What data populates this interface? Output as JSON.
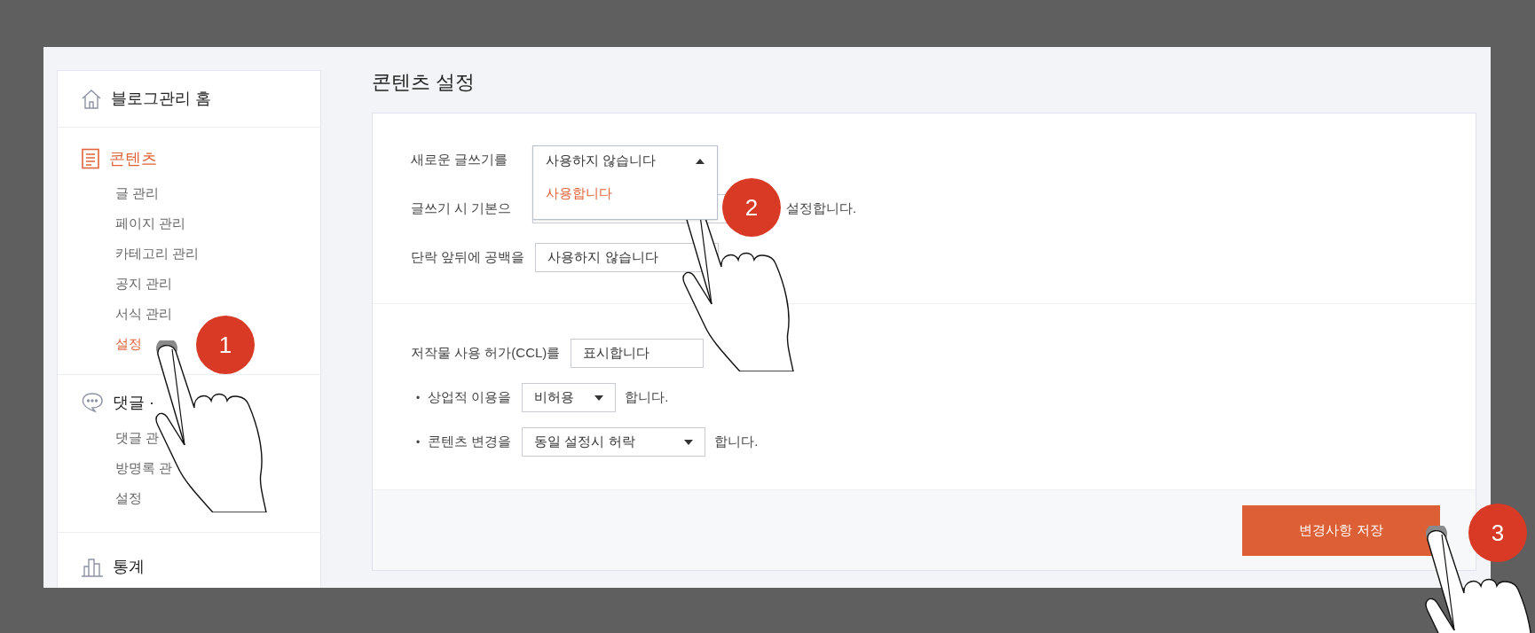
{
  "sidebar": {
    "sections": [
      {
        "title": "블로그관리 홈",
        "active": false
      },
      {
        "title": "콘텐츠",
        "active": true,
        "items": [
          {
            "label": "글 관리",
            "selected": false
          },
          {
            "label": "페이지 관리",
            "selected": false
          },
          {
            "label": "카테고리 관리",
            "selected": false
          },
          {
            "label": "공지 관리",
            "selected": false
          },
          {
            "label": "서식 관리",
            "selected": false
          },
          {
            "label": "설정",
            "selected": true
          }
        ]
      },
      {
        "title": "댓글 ·",
        "active": false,
        "items": [
          {
            "label": "댓글 관",
            "selected": false
          },
          {
            "label": "방명록 관",
            "selected": false
          },
          {
            "label": "설정",
            "selected": false
          }
        ]
      },
      {
        "title": "통계",
        "active": false
      }
    ]
  },
  "page_title": "콘텐츠 설정",
  "settings": {
    "groups": [
      {
        "rows": [
          {
            "kind": "dropdown",
            "label": "새로운 글쓰기를",
            "value": "사용하지 않습니다",
            "expanded": true,
            "options": [
              {
                "label": "사용합니다",
                "highlighted": true
              }
            ]
          },
          {
            "kind": "covered_select",
            "label": "글쓰기 시 기본으",
            "suffix": "설정합니다."
          },
          {
            "kind": "plain_select",
            "label": "단락 앞뒤에 공백을",
            "value": "사용하지 않습니다"
          }
        ]
      },
      {
        "rows": [
          {
            "kind": "plain_select",
            "label": "저작물 사용 허가(CCL)를",
            "value": "표시합니다"
          },
          {
            "kind": "select",
            "bullet": "•",
            "label": "상업적 이용을",
            "value": "비허용",
            "suffix": "합니다."
          },
          {
            "kind": "select",
            "bullet": "•",
            "label": "콘텐츠 변경을",
            "value": "동일 설정시 허락",
            "suffix": "합니다."
          }
        ]
      }
    ]
  },
  "save_button": "변경사항 저장",
  "annotations": [
    {
      "label": "1"
    },
    {
      "label": "2"
    },
    {
      "label": "3"
    }
  ]
}
